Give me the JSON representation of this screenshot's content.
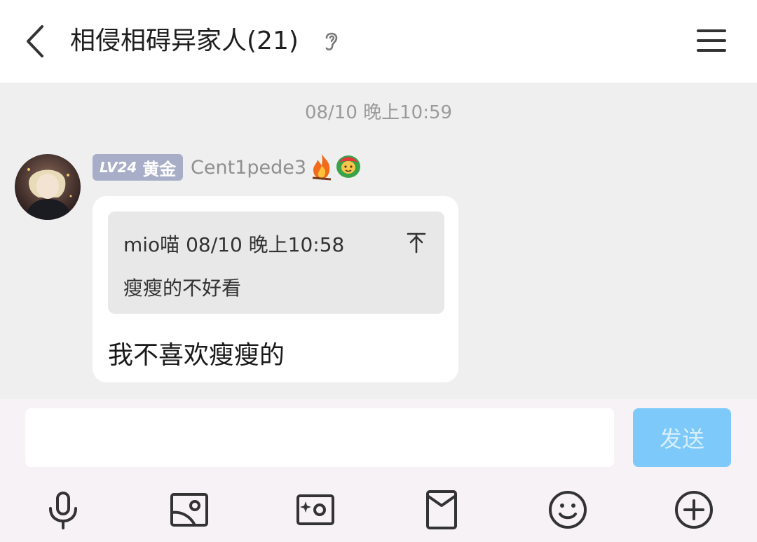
{
  "header": {
    "title": "相侵相碍异家人(21)"
  },
  "chat": {
    "timestamp": "08/10 晚上10:59",
    "message": {
      "level": "LV24",
      "rank": "黄金",
      "username": "Cent1pede3",
      "quote": {
        "author_time": "mio喵 08/10 晚上10:58",
        "text": "瘦瘦的不好看"
      },
      "text": "我不喜欢瘦瘦的"
    }
  },
  "composer": {
    "input_value": "",
    "send_label": "发送"
  },
  "icons": {
    "toolbar": [
      "microphone-icon",
      "image-icon",
      "camera-icon",
      "red-packet-icon",
      "emoji-icon",
      "plus-icon"
    ]
  },
  "colors": {
    "accent": "#7dc9fa",
    "badge": "#a9aec8"
  }
}
